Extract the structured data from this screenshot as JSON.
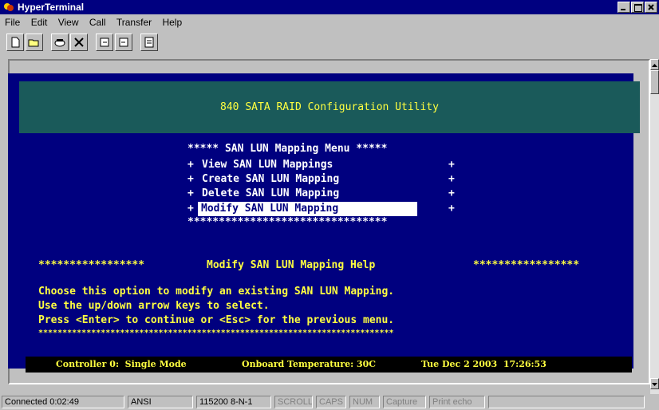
{
  "window": {
    "title": "HyperTerminal"
  },
  "menu": [
    "File",
    "Edit",
    "View",
    "Call",
    "Transfer",
    "Help"
  ],
  "toolbar": [
    "new-icon",
    "open-icon",
    "connect-icon",
    "disconnect-icon",
    "send-icon",
    "receive-icon",
    "properties-icon"
  ],
  "terminal": {
    "header": "840 SATA RAID Configuration Utility",
    "menu_title": "***** SAN LUN Mapping Menu *****",
    "items": [
      {
        "text": "View SAN LUN Mappings"
      },
      {
        "text": "Create SAN LUN Mapping"
      },
      {
        "text": "Delete SAN LUN Mapping"
      },
      {
        "text": "Modify SAN LUN Mapping",
        "selected": true
      }
    ],
    "menu_bottom": "********************************",
    "help": {
      "title": "Modify SAN LUN Mapping Help",
      "stars": "*****************",
      "lines": [
        "Choose this option to modify an existing SAN LUN Mapping.",
        "Use the up/down arrow keys to select.",
        "Press <Enter> to continue or <Esc> for the previous menu."
      ],
      "bottom": "**************************************************************************"
    },
    "status": {
      "controller": "Controller 0:  Single Mode",
      "temperature": "Onboard Temperature: 30C",
      "datetime": "Tue Dec 2 2003  17:26:53"
    }
  },
  "statusbar": {
    "connected": "Connected 0:02:49",
    "emulation": "ANSI",
    "settings": "115200 8-N-1",
    "scroll": "SCROLL",
    "caps": "CAPS",
    "num": "NUM",
    "capture": "Capture",
    "printecho": "Print echo"
  }
}
